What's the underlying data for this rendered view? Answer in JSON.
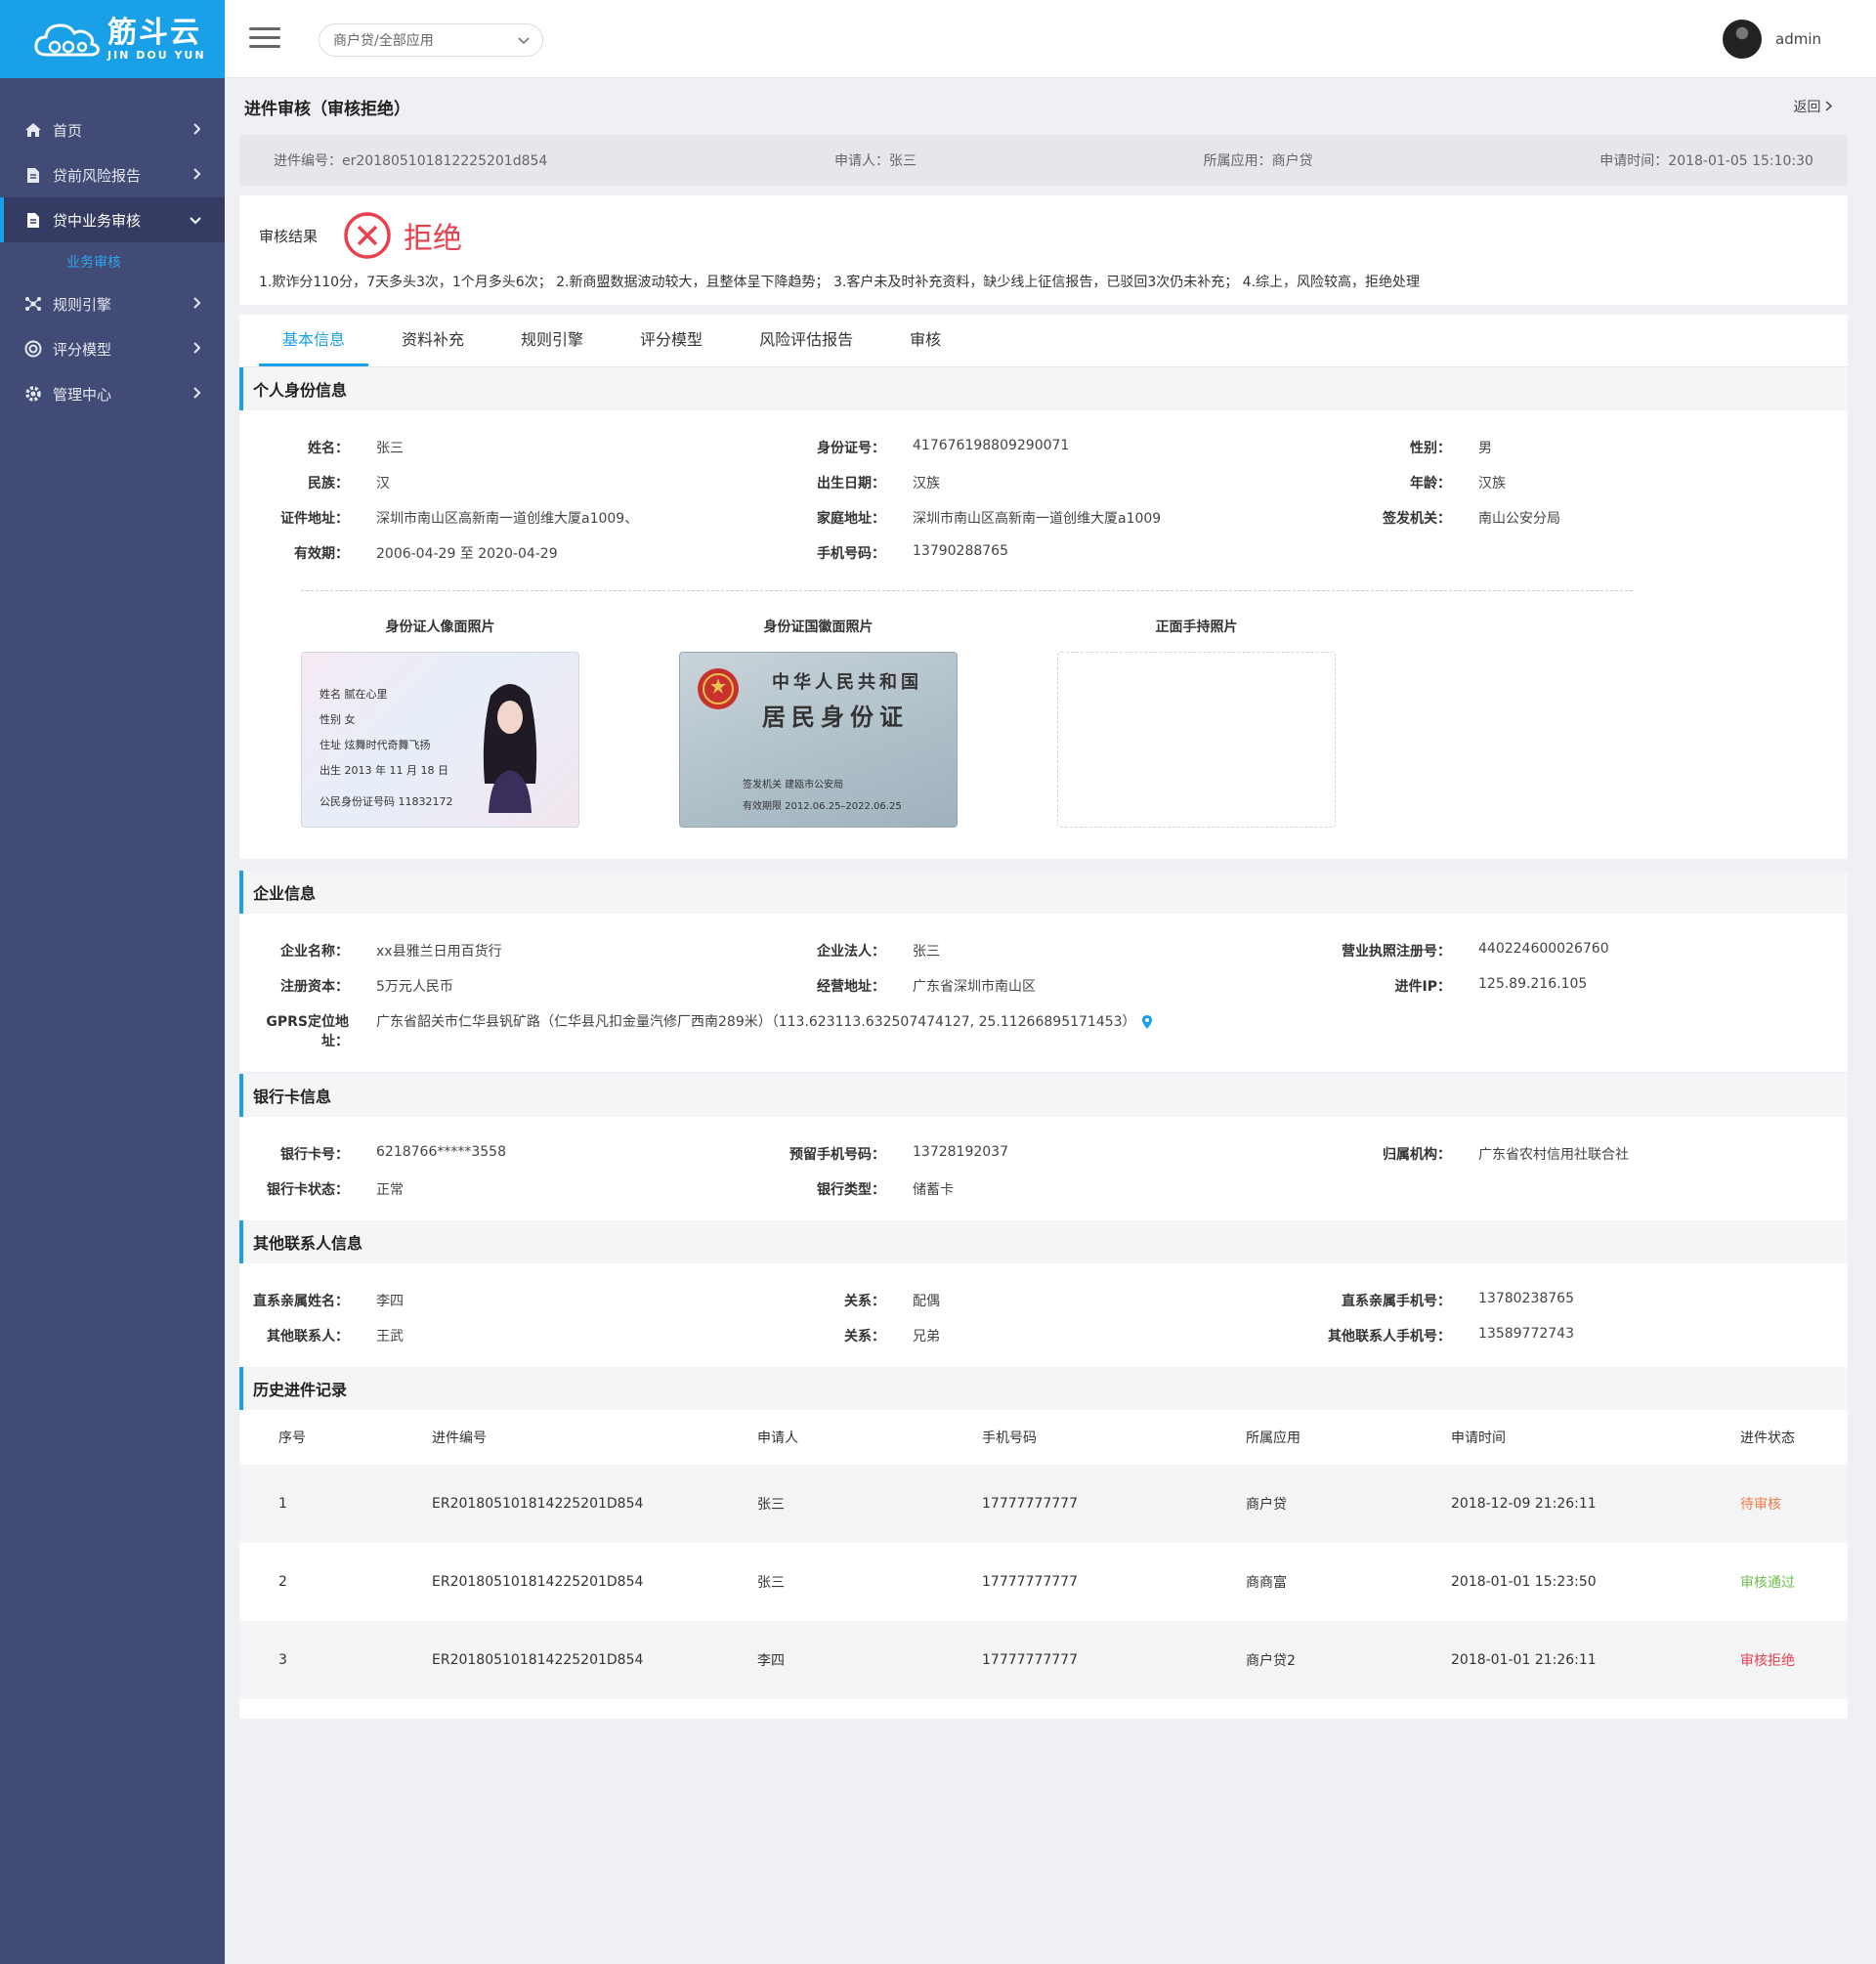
{
  "brand": {
    "name_cn": "筋斗云",
    "name_en": "JIN DOU YUN",
    "color": "#1aa0e6"
  },
  "sidebar": {
    "items": [
      {
        "label": "首页",
        "icon": "home-icon"
      },
      {
        "label": "贷前风险报告",
        "icon": "document-icon"
      },
      {
        "label": "贷中业务审核",
        "icon": "document-icon",
        "active": true
      },
      {
        "label": "规则引擎",
        "icon": "network-icon"
      },
      {
        "label": "评分模型",
        "icon": "target-icon"
      },
      {
        "label": "管理中心",
        "icon": "gear-icon"
      }
    ],
    "subitem": "业务审核"
  },
  "header": {
    "app_select": "商户贷/全部应用",
    "user": "admin"
  },
  "page": {
    "title": "进件审核（审核拒绝）",
    "back": "返回",
    "info": {
      "code": "进件编号：er2018051018122252​01d854",
      "applicant": "申请人：张三",
      "app": "所属应用：商户贷",
      "time": "申请时间：2018-01-05 15:10:30"
    }
  },
  "result": {
    "label": "审核结果",
    "status": "拒绝",
    "reason": "1.欺诈分110分，7天多头3次，1个月多头6次； 2.新商盟数据波动较大，且整体呈下降趋势； 3.客户未及时补充资料，缺少线上征信报告，已驳回3次仍未补充； 4.综上，风险较高，拒绝处理"
  },
  "tabs": [
    "基本信息",
    "资料补充",
    "规则引擎",
    "评分模型",
    "风险评估报告",
    "审核"
  ],
  "personal": {
    "title": "个人身份信息",
    "rows": [
      [
        "姓名：",
        "张三",
        "身份证号：",
        "417676198809290071",
        "性别：",
        "男"
      ],
      [
        "民族：",
        "汉",
        "出生日期：",
        "汉族",
        "年龄：",
        "汉族"
      ],
      [
        "证件地址：",
        "深圳市南山区高新南一道创维大厦a1009、",
        "家庭地址：",
        "深圳市南山区高新南一道创维大厦a1009",
        "签发机关：",
        "南山公安分局"
      ],
      [
        "有效期：",
        "2006-04-29  至  2020-04-29",
        "手机号码：",
        "13790288765",
        "",
        ""
      ]
    ],
    "photos": {
      "front_caption": "身份证人像面照片",
      "back_caption": "身份证国徽面照片",
      "hand_caption": "正面手持照片",
      "front": {
        "name": "姓名   腻在心里",
        "gender": "性别   女",
        "addr": "住址   炫舞时代奇舞飞扬",
        "birth": "出生   2013 年 11 月 18 日",
        "idno": "公民身份证号码     11832172"
      },
      "back": {
        "t1": "中华人民共和国",
        "t2": "居民身份证",
        "issuer": "签发机关    建瓯市公安局",
        "valid": "有效期限    2012.06.25–2022.06.25"
      }
    }
  },
  "company": {
    "title": "企业信息",
    "rows": [
      [
        "企业名称：",
        "xx县雅兰日用百货行",
        "企业法人：",
        "张三",
        "营业执照注册号：",
        "440224600026760"
      ],
      [
        "注册资本：",
        "5万元人民币",
        "经营地址：",
        "广东省深圳市南山区",
        "进件IP：",
        "125.89.216.105"
      ]
    ],
    "gps_label": "GPRS定位地址：",
    "gps_value": "广东省韶关市仁华县钒矿路（仁华县凡扣金量汽修厂西南289米）（113.623113.632507474127, 25.11266895171453）"
  },
  "bank": {
    "title": "银行卡信息",
    "rows": [
      [
        "银行卡号：",
        "6218766*****3558",
        "预留手机号码：",
        "13728192037",
        "归属机构：",
        "广东省农村信用社联合社"
      ],
      [
        "银行卡状态：",
        "正常",
        "银行类型：",
        "储蓄卡",
        "",
        ""
      ]
    ]
  },
  "contacts": {
    "title": "其他联系人信息",
    "rows": [
      [
        "直系亲属姓名：",
        "李四",
        "关系：",
        "配偶",
        "直系亲属手机号：",
        "13780238765"
      ],
      [
        "其他联系人：",
        "王武",
        "关系：",
        "兄弟",
        "其他联系人手机号：",
        "13589772743"
      ]
    ]
  },
  "history": {
    "title": "历史进件记录",
    "headers": [
      "序号",
      "进件编号",
      "申请人",
      "手机号码",
      "所属应用",
      "申请时间",
      "进件状态"
    ],
    "rows": [
      [
        "1",
        "ER2018051018142252​01D854",
        "张三",
        "17777777777",
        "商户贷",
        "2018-12-09  21:26:11",
        "待审核"
      ],
      [
        "2",
        "ER2018051018142252​01D854",
        "张三",
        "17777777777",
        "商商富",
        "2018-01-01  15:23:50",
        "审核通过"
      ],
      [
        "3",
        "ER2018051018142252​01D854",
        "李四",
        "17777777777",
        "商户贷2",
        "2018-01-01  21:26:11",
        "审核拒绝"
      ]
    ]
  },
  "colors": {
    "accent": "#1aa0e6",
    "sidebar": "#424a76",
    "reject": "#e8414e",
    "pending": "#f07a45",
    "pass": "#6fbf4c"
  }
}
